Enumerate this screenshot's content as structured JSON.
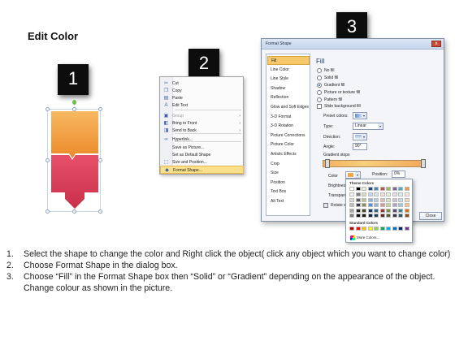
{
  "title": "Edit Color",
  "badges": [
    "1",
    "2",
    "3"
  ],
  "context_menu": {
    "items": [
      {
        "label": "Cut",
        "icon": "scissors-icon",
        "glyph": "✂",
        "disabled": false,
        "submenu": false
      },
      {
        "label": "Copy",
        "icon": "copy-icon",
        "glyph": "❐",
        "disabled": false,
        "submenu": false
      },
      {
        "label": "Paste",
        "icon": "paste-icon",
        "glyph": "▤",
        "disabled": false,
        "submenu": false
      },
      {
        "label": "Edit Text",
        "icon": "edit-text-icon",
        "glyph": "A",
        "disabled": false,
        "submenu": false
      },
      {
        "label": "Group",
        "icon": "group-icon",
        "glyph": "▣",
        "disabled": true,
        "submenu": true
      },
      {
        "label": "Bring to Front",
        "icon": "bring-front-icon",
        "glyph": "◧",
        "disabled": false,
        "submenu": true
      },
      {
        "label": "Send to Back",
        "icon": "send-back-icon",
        "glyph": "◨",
        "disabled": false,
        "submenu": true
      },
      {
        "label": "Hyperlink...",
        "icon": "hyperlink-icon",
        "glyph": "∞",
        "disabled": false,
        "submenu": false
      },
      {
        "label": "Save as Picture...",
        "icon": "",
        "glyph": "",
        "disabled": false,
        "submenu": false
      },
      {
        "label": "Set as Default Shape",
        "icon": "",
        "glyph": "",
        "disabled": false,
        "submenu": false
      },
      {
        "label": "Size and Position...",
        "icon": "size-icon",
        "glyph": "⬚",
        "disabled": false,
        "submenu": false
      },
      {
        "label": "Format Shape...",
        "icon": "format-shape-icon",
        "glyph": "◆",
        "disabled": false,
        "submenu": false,
        "highlighted": true
      }
    ]
  },
  "dialog": {
    "title": "Format Shape",
    "close_glyph": "x",
    "categories": [
      "Fill",
      "Line Color",
      "Line Style",
      "Shadow",
      "Reflection",
      "Glow and Soft Edges",
      "3-D Format",
      "3-D Rotation",
      "Picture Corrections",
      "Picture Color",
      "Artistic Effects",
      "Crop",
      "Size",
      "Position",
      "Text Box",
      "Alt Text"
    ],
    "selected_category": "Fill",
    "fill_heading": "Fill",
    "fill_options": [
      "No fill",
      "Solid fill",
      "Gradient fill",
      "Picture or texture fill",
      "Pattern fill"
    ],
    "selected_fill": "Gradient fill",
    "slide_background_label": "Slide background fill",
    "preset_colors_label": "Preset colors:",
    "type_label": "Type:",
    "type_value": "Linear",
    "direction_label": "Direction:",
    "angle_label": "Angle:",
    "angle_value": "90°",
    "gradient_stops_label": "Gradient stops",
    "color_label": "Color",
    "position_label": "Position:",
    "position_value": "0%",
    "brightness_label": "Brightness:",
    "transparency_label": "Transparency:",
    "rotate_label": "Rotate with shape",
    "close_button": "Close"
  },
  "palette": {
    "theme_heading": "Theme Colors",
    "standard_heading": "Standard Colors",
    "more_colors": "More Colors...",
    "theme_top": [
      "#ffffff",
      "#000000",
      "#eeece1",
      "#1f497d",
      "#4f81bd",
      "#c0504d",
      "#9bbb59",
      "#8064a2",
      "#4bacc6",
      "#f79646"
    ],
    "theme_shades": [
      [
        "#f2f2f2",
        "#7f7f7f",
        "#ddd9c3",
        "#c6d9f0",
        "#dbe5f1",
        "#f2dcdb",
        "#ebf1dd",
        "#e5e0ec",
        "#dbeef3",
        "#fdeada"
      ],
      [
        "#d8d8d8",
        "#595959",
        "#c4bd97",
        "#8db3e2",
        "#b8cce4",
        "#e5b9b7",
        "#d7e3bc",
        "#ccc1d9",
        "#b7dde8",
        "#fbd5b5"
      ],
      [
        "#bfbfbf",
        "#3f3f3f",
        "#938953",
        "#548dd4",
        "#95b3d7",
        "#d99694",
        "#c3d69b",
        "#b2a2c7",
        "#92cddc",
        "#fac08f"
      ],
      [
        "#a5a5a5",
        "#262626",
        "#494429",
        "#17365d",
        "#366092",
        "#953734",
        "#76923c",
        "#5f497a",
        "#31859b",
        "#e36c09"
      ],
      [
        "#7f7f7f",
        "#0c0c0c",
        "#1d1b10",
        "#0f243e",
        "#244061",
        "#632423",
        "#4f6128",
        "#3f3151",
        "#205867",
        "#974806"
      ]
    ],
    "standard": [
      "#c00000",
      "#ff0000",
      "#ffc000",
      "#ffff00",
      "#92d050",
      "#00b050",
      "#00b0f0",
      "#0070c0",
      "#002060",
      "#7030a0"
    ]
  },
  "instructions": [
    {
      "num": "1.",
      "text": "Select the shape to change the color and Right click the object( click any object which you want to change color)"
    },
    {
      "num": "2.",
      "text": "Choose Format Shape in the dialog box."
    },
    {
      "num": "3.",
      "text": "Choose “Fill” in the Format Shape box then “Solid” or “Gradient” depending on the appearance of the object. Change colour as shown in the picture."
    }
  ],
  "colors": {
    "shape_top": "#f39a3c",
    "shape_bottom": "#e0445c",
    "menu_highlight": "#fbe08c",
    "dialog_selected": "#f6c86a"
  }
}
